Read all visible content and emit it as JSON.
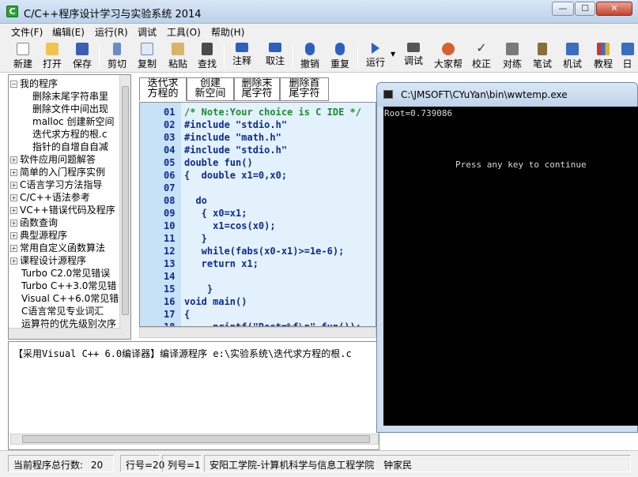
{
  "window": {
    "title": "C/C++程序设计学习与实验系统 2014",
    "minimize": "—",
    "maximize": "☐",
    "close": "✕"
  },
  "menu": {
    "items": [
      "文件(F)",
      "编辑(E)",
      "运行(R)",
      "调试",
      "工具(O)",
      "帮助(H)"
    ]
  },
  "toolbar": {
    "buttons": [
      {
        "label": "新建",
        "icon": "new-file-icon",
        "color": "#ffffff"
      },
      {
        "label": "打开",
        "icon": "folder-open-icon",
        "color": "#f2c34f"
      },
      {
        "label": "保存",
        "icon": "save-icon",
        "color": "#3b5fb4"
      },
      {
        "label": "剪切",
        "icon": "scissors-icon",
        "color": "#6b8cc7"
      },
      {
        "label": "复制",
        "icon": "copy-icon",
        "color": "#dfe9f6"
      },
      {
        "label": "粘贴",
        "icon": "paste-icon",
        "color": "#d8b36a"
      },
      {
        "label": "查找",
        "icon": "binoculars-icon",
        "color": "#4b4b4b"
      },
      {
        "label": "注释",
        "icon": "comment-icon",
        "color": "#2d5fbf"
      },
      {
        "label": "取注",
        "icon": "uncomment-icon",
        "color": "#2d5fbf"
      },
      {
        "label": "撤销",
        "icon": "undo-icon",
        "color": "#2d5fbf"
      },
      {
        "label": "重复",
        "icon": "redo-icon",
        "color": "#2d5fbf"
      },
      {
        "label": "运行",
        "icon": "run-icon",
        "color": "#2d5fbf"
      },
      {
        "label": "调试",
        "icon": "debug-icon",
        "color": "#555555"
      },
      {
        "label": "大家帮",
        "icon": "people-icon",
        "color": "#d6612f"
      },
      {
        "label": "校正",
        "icon": "check-icon",
        "color": "#3d3d3d"
      },
      {
        "label": "对练",
        "icon": "practice-icon",
        "color": "#7a7a7a"
      },
      {
        "label": "笔试",
        "icon": "exam-icon",
        "color": "#8a6d3b"
      },
      {
        "label": "机试",
        "icon": "computer-test-icon",
        "color": "#3a6ec2"
      },
      {
        "label": "教程",
        "icon": "books-icon",
        "color": "#c23a3a"
      },
      {
        "label": "日",
        "icon": "calendar-icon",
        "color": "#3a6ec2"
      }
    ]
  },
  "tree": {
    "items": [
      {
        "label": "我的程序",
        "level": 0,
        "expander": "−"
      },
      {
        "label": "删除末尾字符串里",
        "level": 2,
        "expander": ""
      },
      {
        "label": "删除文件中间出现",
        "level": 2,
        "expander": ""
      },
      {
        "label": "malloc 创建新空间",
        "level": 2,
        "expander": ""
      },
      {
        "label": "迭代求方程的根.c",
        "level": 2,
        "expander": ""
      },
      {
        "label": "指针的自增自自减",
        "level": 2,
        "expander": ""
      },
      {
        "label": "软件应用问题解答",
        "level": 0,
        "expander": "+"
      },
      {
        "label": "简单的入门程序实例",
        "level": 0,
        "expander": "+"
      },
      {
        "label": "C语言学习方法指导",
        "level": 0,
        "expander": "+"
      },
      {
        "label": "C/C++语法参考",
        "level": 0,
        "expander": "+"
      },
      {
        "label": "VC++错误代码及程序",
        "level": 0,
        "expander": "+"
      },
      {
        "label": "函数查询",
        "level": 0,
        "expander": "+"
      },
      {
        "label": "典型源程序",
        "level": 0,
        "expander": "+"
      },
      {
        "label": "常用自定义函数算法",
        "level": 0,
        "expander": "+"
      },
      {
        "label": "课程设计源程序",
        "level": 0,
        "expander": "+"
      },
      {
        "label": "Turbo C2.0常见错误",
        "level": 1,
        "expander": ""
      },
      {
        "label": "Turbo C++3.0常见错",
        "level": 1,
        "expander": ""
      },
      {
        "label": "Visual C++6.0常见错",
        "level": 1,
        "expander": ""
      },
      {
        "label": "C语言常见专业词汇",
        "level": 1,
        "expander": ""
      },
      {
        "label": "运算符的优先级别次序",
        "level": 1,
        "expander": ""
      }
    ]
  },
  "tabs": [
    {
      "label": "迭代求\n方程的",
      "active": true
    },
    {
      "label": "创建\n新空间",
      "active": false
    },
    {
      "label": "删除末\n尾字符",
      "active": false
    },
    {
      "label": "删除首\n尾字符",
      "active": false
    }
  ],
  "editor": {
    "lines": [
      {
        "no": "01",
        "text": "/* Note:Your choice is C IDE */",
        "kind": "comment"
      },
      {
        "no": "02",
        "text": "#include \"stdio.h\"",
        "kind": "include"
      },
      {
        "no": "03",
        "text": "#include \"math.h\"",
        "kind": "include"
      },
      {
        "no": "04",
        "text": "#include \"stdio.h\"",
        "kind": "include"
      },
      {
        "no": "05",
        "text": "double fun()",
        "kind": "code"
      },
      {
        "no": "06",
        "text": "{  double x1=0,x0;",
        "kind": "code"
      },
      {
        "no": "07",
        "text": "",
        "kind": "code"
      },
      {
        "no": "08",
        "text": "  do",
        "kind": "code"
      },
      {
        "no": "09",
        "text": "   { x0=x1;",
        "kind": "code"
      },
      {
        "no": "10",
        "text": "     x1=cos(x0);",
        "kind": "code"
      },
      {
        "no": "11",
        "text": "   }",
        "kind": "code"
      },
      {
        "no": "12",
        "text": "   while(fabs(x0-x1)>=1e-6);",
        "kind": "code"
      },
      {
        "no": "13",
        "text": "   return x1;",
        "kind": "code"
      },
      {
        "no": "14",
        "text": "",
        "kind": "code"
      },
      {
        "no": "15",
        "text": "    }",
        "kind": "code"
      },
      {
        "no": "16",
        "text": "void main()",
        "kind": "code"
      },
      {
        "no": "17",
        "text": "{",
        "kind": "code"
      },
      {
        "no": "18",
        "text": "     printf(\"Root=%f\\n\",fun());",
        "kind": "code"
      }
    ]
  },
  "output": {
    "text": "【采用Visual C++ 6.0编译器】编译源程序 e:\\实验系统\\迭代求方程的根.c"
  },
  "status": {
    "total_label": "当前程序总行数:",
    "total_value": "20",
    "line": "行号=20",
    "column": "列号=1",
    "credit": "安阳工学院-计算机科学与信息工程学院",
    "author": "钟家民"
  },
  "console": {
    "title": "C:\\JMSOFT\\CYuYan\\bin\\wwtemp.exe",
    "output_line": "Root=0.739086",
    "prompt": "Press any key to continue"
  },
  "colors": {
    "editor_bg": "#e3f1fc",
    "gutter_bg": "#c7e1f7",
    "code_keyword": "#0b2c93",
    "code_string": "#2e7dbd",
    "code_comment": "#1a8c2e",
    "console_bg": "#000000"
  }
}
